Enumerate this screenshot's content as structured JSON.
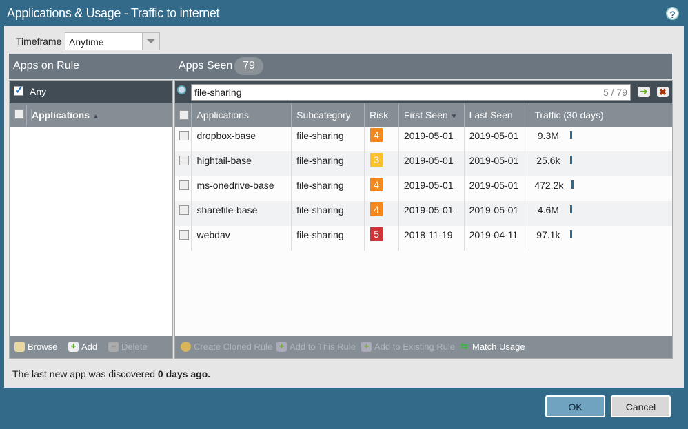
{
  "title": "Applications & Usage - Traffic to internet",
  "timeframe": {
    "label": "Timeframe",
    "value": "Anytime"
  },
  "apps_on_rule": {
    "title": "Apps on Rule",
    "any_label": "Any",
    "any_checked": true,
    "column": "Applications",
    "browse": "Browse",
    "add": "Add",
    "delete": "Delete"
  },
  "apps_seen": {
    "title": "Apps Seen",
    "count": "79",
    "search_value": "file-sharing",
    "match_count": "5 / 79",
    "columns": [
      "Applications",
      "Subcategory",
      "Risk",
      "First Seen",
      "Last Seen",
      "Traffic (30 days)"
    ],
    "rows": [
      {
        "app": "dropbox-base",
        "sub": "file-sharing",
        "risk": "4",
        "first": "2019-05-01",
        "last": "2019-05-01",
        "traffic": "9.3M"
      },
      {
        "app": "hightail-base",
        "sub": "file-sharing",
        "risk": "3",
        "first": "2019-05-01",
        "last": "2019-05-01",
        "traffic": "25.6k"
      },
      {
        "app": "ms-onedrive-base",
        "sub": "file-sharing",
        "risk": "4",
        "first": "2019-05-01",
        "last": "2019-05-01",
        "traffic": "472.2k"
      },
      {
        "app": "sharefile-base",
        "sub": "file-sharing",
        "risk": "4",
        "first": "2019-05-01",
        "last": "2019-05-01",
        "traffic": "4.6M"
      },
      {
        "app": "webdav",
        "sub": "file-sharing",
        "risk": "5",
        "first": "2018-11-19",
        "last": "2019-04-11",
        "traffic": "97.1k"
      }
    ],
    "actions": {
      "clone": "Create Cloned Rule",
      "add_this": "Add to This Rule",
      "add_existing": "Add to Existing Rule",
      "match": "Match Usage"
    }
  },
  "risk_colors": {
    "3": "#fbc02d",
    "4": "#f5871f",
    "5": "#d13438"
  },
  "status": {
    "prefix": "The last new app was discovered ",
    "bold": "0 days ago."
  },
  "buttons": {
    "ok": "OK",
    "cancel": "Cancel"
  }
}
